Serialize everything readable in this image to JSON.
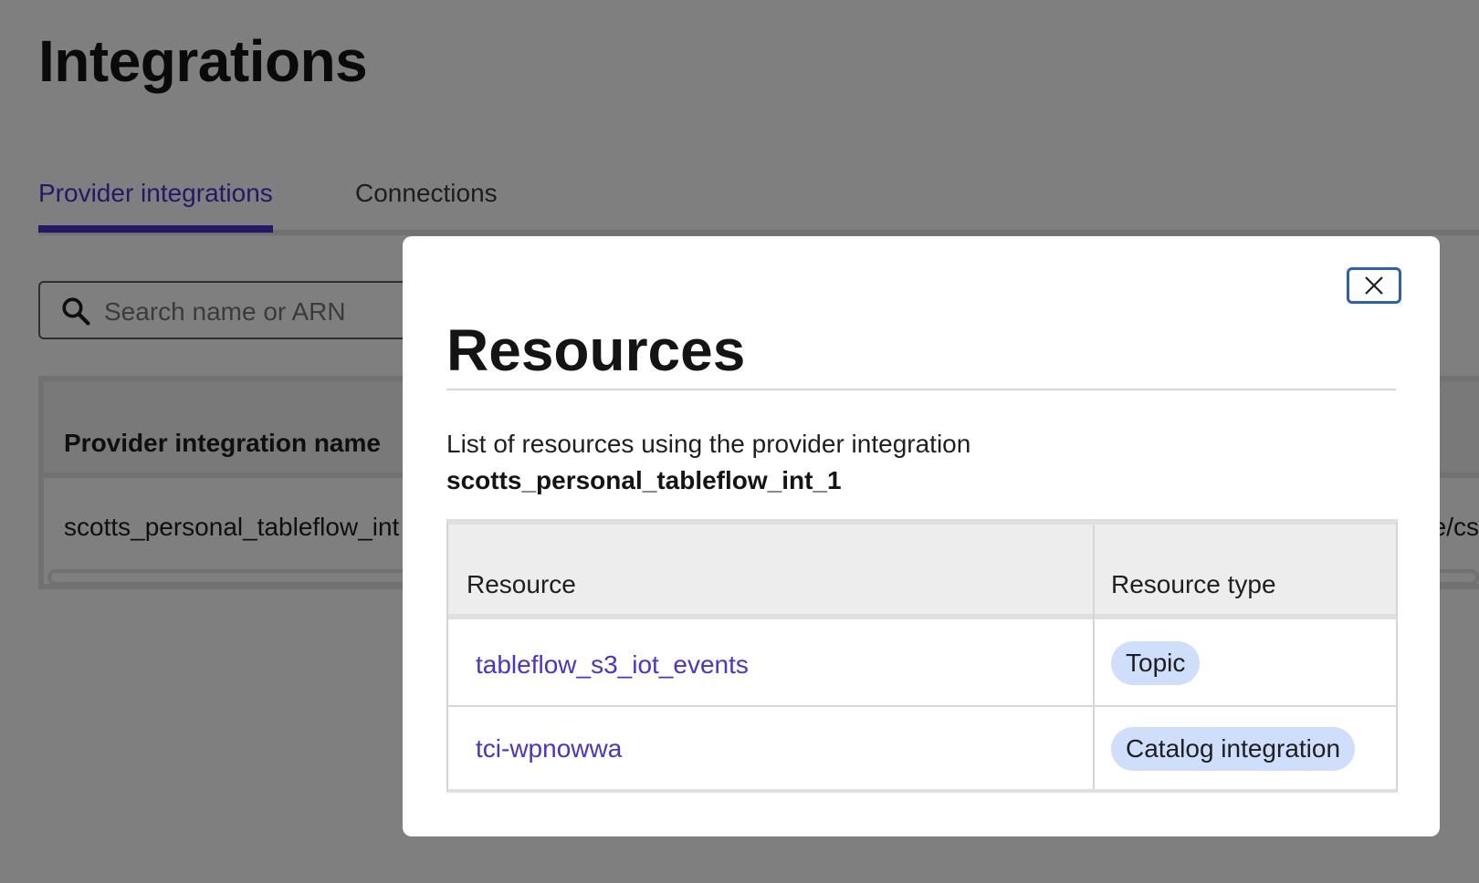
{
  "page": {
    "title": "Integrations",
    "tabs": [
      {
        "label": "Provider integrations",
        "active": true
      },
      {
        "label": "Connections",
        "active": false
      }
    ],
    "search": {
      "placeholder": "Search name or ARN"
    },
    "table": {
      "header": "Provider integration name",
      "row_name": "scotts_personal_tableflow_int",
      "row_right_fragment": "e/cs"
    }
  },
  "modal": {
    "title": "Resources",
    "description": "List of resources using the provider integration",
    "integration_name": "scotts_personal_tableflow_int_1",
    "close_icon": "close-icon",
    "table": {
      "columns": [
        "Resource",
        "Resource type"
      ],
      "rows": [
        {
          "resource": "tableflow_s3_iot_events",
          "type": "Topic"
        },
        {
          "resource": "tci-wpnowwa",
          "type": "Catalog integration"
        }
      ]
    }
  },
  "colors": {
    "accent": "#4933d2",
    "badge": "#cfdefa",
    "focus": "#2c5fb6"
  }
}
